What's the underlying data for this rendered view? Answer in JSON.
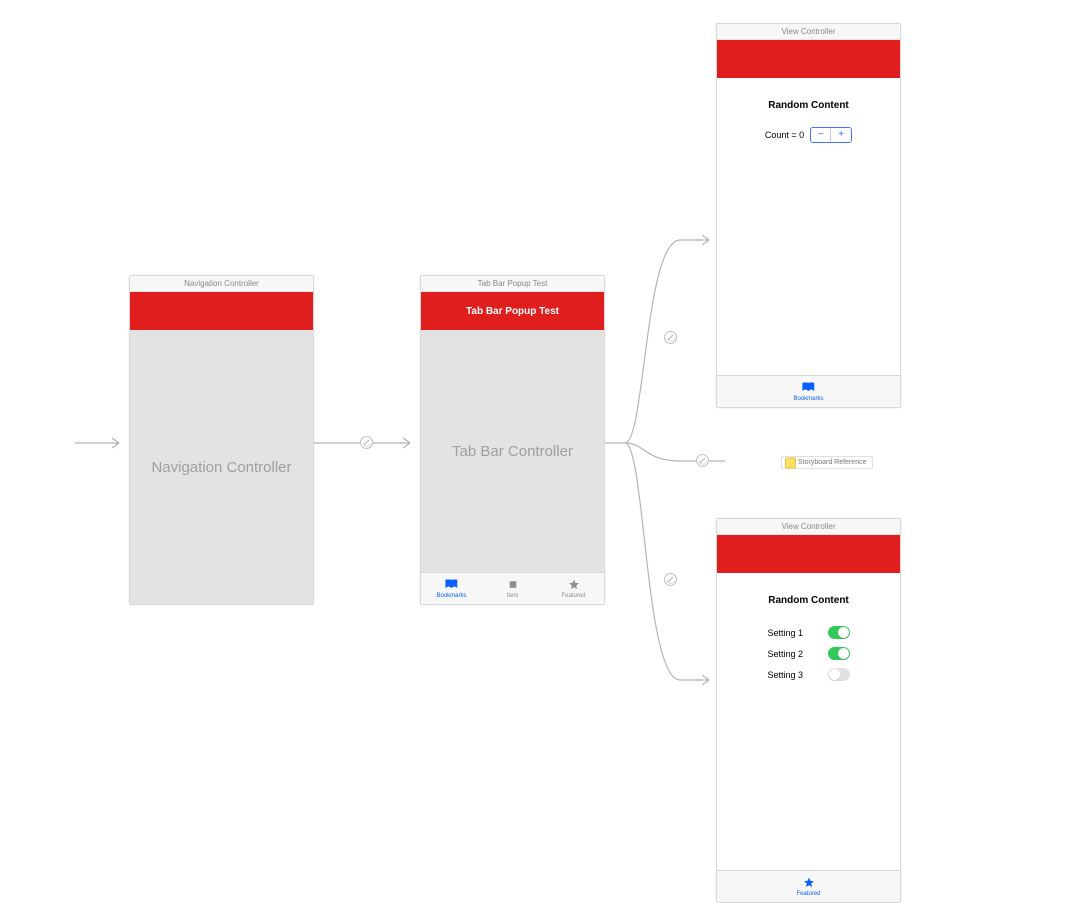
{
  "navController": {
    "sceneTitle": "Navigation Controller",
    "bodyLabel": "Navigation Controller"
  },
  "tabController": {
    "sceneTitle": "Tab Bar Popup Test",
    "navTitle": "Tab Bar Popup Test",
    "bodyLabel": "Tab Bar Controller",
    "tabs": [
      {
        "label": "Bookmarks",
        "active": true
      },
      {
        "label": "Item",
        "active": false
      },
      {
        "label": "Featured",
        "active": false
      }
    ]
  },
  "vcTop": {
    "sceneTitle": "View Controller",
    "contentTitle": "Random Content",
    "countLabel": "Count = 0",
    "tabLabel": "Bookmarks"
  },
  "vcBottom": {
    "sceneTitle": "View Controller",
    "contentTitle": "Random Content",
    "settings": [
      {
        "label": "Setting 1",
        "on": true
      },
      {
        "label": "Setting 2",
        "on": true
      },
      {
        "label": "Setting 3",
        "on": false
      }
    ],
    "tabLabel": "Featured"
  },
  "storyboardRef": {
    "label": "Storyboard Reference"
  },
  "colors": {
    "navbar": "#e11e1e",
    "accent": "#0a60ff",
    "switchOn": "#34c759"
  }
}
